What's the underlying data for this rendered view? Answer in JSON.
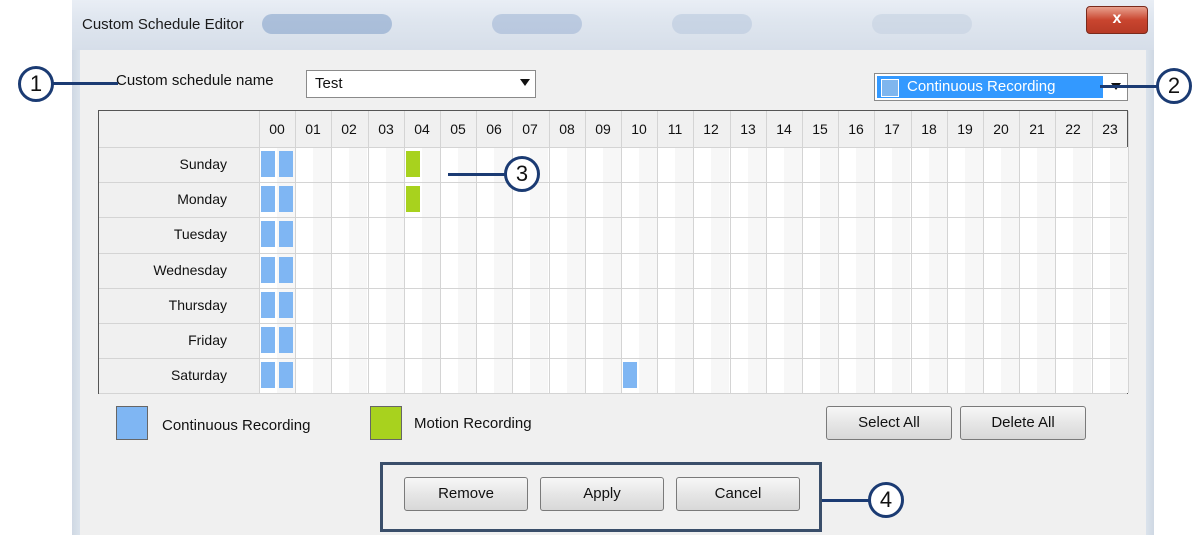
{
  "window": {
    "title": "Custom Schedule Editor",
    "close_label": "x"
  },
  "schedule_name": {
    "label": "Custom schedule name",
    "value": "Test"
  },
  "record_type_select": {
    "value": "Continuous Recording"
  },
  "grid": {
    "hours": [
      "00",
      "01",
      "02",
      "03",
      "04",
      "05",
      "06",
      "07",
      "08",
      "09",
      "10",
      "11",
      "12",
      "13",
      "14",
      "15",
      "16",
      "17",
      "18",
      "19",
      "20",
      "21",
      "22",
      "23"
    ],
    "days": [
      "Sunday",
      "Monday",
      "Tuesday",
      "Wednesday",
      "Thursday",
      "Friday",
      "Saturday"
    ]
  },
  "legend": {
    "continuous_label": "Continuous Recording",
    "motion_label": "Motion Recording"
  },
  "buttons": {
    "select_all": "Select All",
    "delete_all": "Delete All",
    "remove": "Remove",
    "apply": "Apply",
    "cancel": "Cancel"
  },
  "callouts": [
    "1",
    "2",
    "3",
    "4"
  ],
  "colors": {
    "continuous": "#7fb6f3",
    "motion": "#a8d21e",
    "selection": "#3399ff",
    "callout": "#1b3b73"
  }
}
